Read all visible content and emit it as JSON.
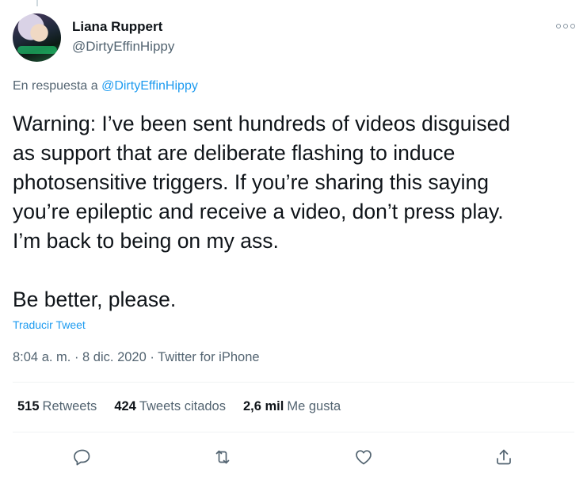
{
  "author": {
    "display_name": "Liana Ruppert",
    "handle": "@DirtyEffinHippy"
  },
  "reply": {
    "prefix": "En respuesta a ",
    "handle": "@DirtyEffinHippy"
  },
  "tweet": {
    "lines": [
      "Warning: I’ve been sent hundreds of videos disguised",
      "as support that are deliberate flashing to induce",
      "photosensitive triggers. If you’re sharing this saying",
      "you’re epileptic and receive a video, don’t press play.",
      "I’m back to being on my ass."
    ],
    "closing": "Be better, please.",
    "translate_label": "Traducir Tweet"
  },
  "meta": {
    "time": "8:04 a. m.",
    "separator": " · ",
    "date": "8 dic. 2020",
    "source": "Twitter for iPhone"
  },
  "stats": {
    "retweets_count": "515",
    "retweets_label": "Retweets",
    "quotes_count": "424",
    "quotes_label": "Tweets citados",
    "likes_count": "2,6 mil",
    "likes_label": "Me gusta"
  },
  "actions": [
    "reply-icon",
    "retweet-icon",
    "like-icon",
    "share-icon"
  ],
  "colors": {
    "accent": "#1d9bf0",
    "text": "#0f1419",
    "secondary": "#536471",
    "divider": "#eff3f4"
  }
}
